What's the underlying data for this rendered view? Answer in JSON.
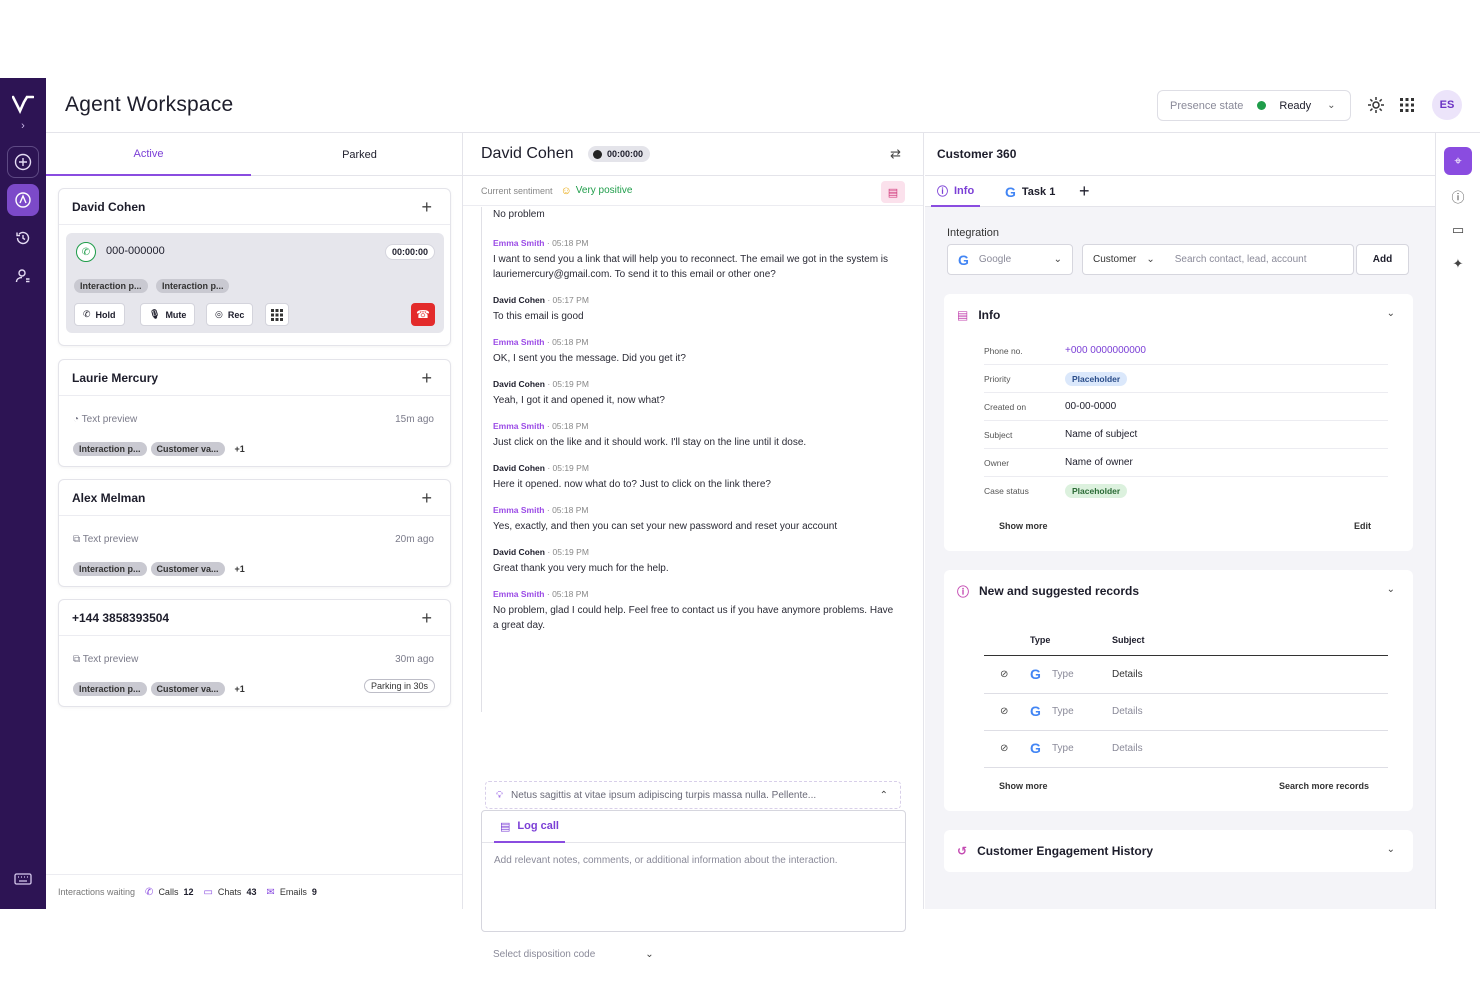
{
  "header": {
    "title": "Agent Workspace",
    "presence_label": "Presence state",
    "presence_value": "Ready",
    "presence_color": "#1f9d4a",
    "avatar_initials": "ES"
  },
  "queue_tabs": [
    "Active",
    "Parked"
  ],
  "active_call": {
    "name": "David Cohen",
    "number": "000-000000",
    "timer": "00:00:00",
    "chips": [
      "Interaction p...",
      "Interaction p..."
    ],
    "buttons": {
      "hold": "Hold",
      "mute": "Mute",
      "rec": "Rec"
    }
  },
  "interactions": [
    {
      "name": "Laurie Mercury",
      "preview": "Text preview",
      "ago": "15m ago",
      "chips": [
        "Interaction p...",
        "Customer va..."
      ],
      "more": "+1"
    },
    {
      "name": "Alex Melman",
      "preview": "Text preview",
      "ago": "20m ago",
      "chips": [
        "Interaction p...",
        "Customer va..."
      ],
      "more": "+1"
    },
    {
      "name": "+144 3858393504",
      "preview": "Text preview",
      "ago": "30m ago",
      "chips": [
        "Interaction p...",
        "Customer va..."
      ],
      "more": "+1",
      "parking": "Parking in 30s"
    }
  ],
  "waiting": {
    "label": "Interactions waiting",
    "calls_label": "Calls",
    "calls": "12",
    "chats_label": "Chats",
    "chats": "43",
    "emails_label": "Emails",
    "emails": "9"
  },
  "chat": {
    "contact": "David Cohen",
    "timer": "00:00:00",
    "sentiment_label": "Current sentiment",
    "sentiment_value": "Very positive",
    "first_line": "No problem",
    "messages": [
      {
        "who": "Emma Smith",
        "time": "05:18 PM",
        "agent": true,
        "text": "I want to send you a link that will help you to reconnect. The email we got in the system is lauriemercury@gmail.com. To send it to this email or other one?"
      },
      {
        "who": "David Cohen",
        "time": "05:17 PM",
        "agent": false,
        "text": "To this email is good"
      },
      {
        "who": "Emma Smith",
        "time": "05:18 PM",
        "agent": true,
        "text": "OK, I sent you the message. Did you get it?"
      },
      {
        "who": "David Cohen",
        "time": "05:19 PM",
        "agent": false,
        "text": "Yeah, I got it and opened it, now what?"
      },
      {
        "who": "Emma Smith",
        "time": "05:18 PM",
        "agent": true,
        "text": "Just click on the like and it should work. I'll stay on the line until it dose."
      },
      {
        "who": "David Cohen",
        "time": "05:19 PM",
        "agent": false,
        "text": "Here it opened. now what do to? Just to click on the link there?"
      },
      {
        "who": "Emma Smith",
        "time": "05:18 PM",
        "agent": true,
        "text": "Yes, exactly, and then you can set your new password and reset your account"
      },
      {
        "who": "David Cohen",
        "time": "05:19 PM",
        "agent": false,
        "text": "Great thank you very much for the help."
      },
      {
        "who": "Emma Smith",
        "time": "05:18 PM",
        "agent": true,
        "text": "No problem, glad I could help. Feel free to contact us if you have anymore problems. Have a great day."
      }
    ],
    "suggestion": "Netus sagittis at vitae ipsum adipiscing turpis massa nulla. Pellente...",
    "log_tab": "Log call",
    "notes_placeholder": "Add relevant notes, comments, or additional information about the interaction.",
    "disposition_placeholder": "Select disposition code"
  },
  "c360": {
    "title": "Customer 360",
    "tabs": {
      "info": "Info",
      "task": "Task 1"
    },
    "integration_label": "Integration",
    "integration_value": "Google",
    "entity_value": "Customer",
    "search_placeholder": "Search contact, lead, account",
    "add_label": "Add",
    "info": {
      "title": "Info",
      "fields": [
        {
          "label": "Phone no.",
          "value": "+000 0000000000",
          "kind": "link"
        },
        {
          "label": "Priority",
          "value": "Placeholder",
          "kind": "badge-blue"
        },
        {
          "label": "Created on",
          "value": "00-00-0000",
          "kind": "text"
        },
        {
          "label": "Subject",
          "value": "Name of subject",
          "kind": "text"
        },
        {
          "label": "Owner",
          "value": "Name of owner",
          "kind": "text"
        },
        {
          "label": "Case status",
          "value": "Placeholder",
          "kind": "badge-green"
        }
      ],
      "show_more": "Show more",
      "edit": "Edit"
    },
    "records": {
      "title": "New and suggested records",
      "col_type": "Type",
      "col_subject": "Subject",
      "rows": [
        {
          "type": "Type",
          "subject": "Details"
        },
        {
          "type": "Type",
          "subject": "Details"
        },
        {
          "type": "Type",
          "subject": "Details"
        }
      ],
      "show_more": "Show more",
      "search_more": "Search more records"
    },
    "history_title": "Customer Engagement History"
  }
}
